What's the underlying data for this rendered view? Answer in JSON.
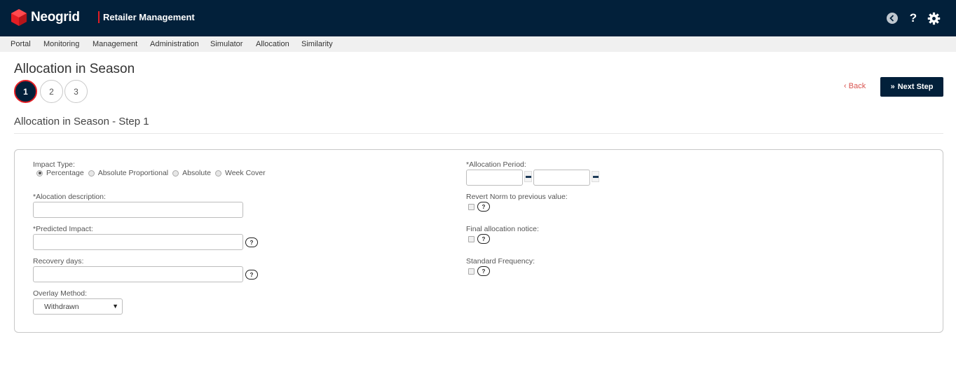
{
  "header": {
    "brand": "Neogrid",
    "app_title": "Retailer Management",
    "icons": [
      "back-circle-icon",
      "help-icon",
      "gear-icon"
    ]
  },
  "menu": {
    "items": [
      "Portal",
      "Monitoring",
      "Management",
      "Administration",
      "Simulator",
      "Allocation",
      "Similarity"
    ]
  },
  "page": {
    "title": "Allocation in Season",
    "steps": [
      "1",
      "2",
      "3"
    ],
    "active_step": "1",
    "back_label": "Back",
    "next_label": "Next Step",
    "section_title": "Allocation in Season - Step 1"
  },
  "form": {
    "impact_type": {
      "label": "Impact Type:",
      "options": [
        "Percentage",
        "Absolute Proportional",
        "Absolute",
        "Week Cover"
      ],
      "selected": "Percentage"
    },
    "allocation_description": {
      "label": "*Alocation description:",
      "value": ""
    },
    "predicted_impact": {
      "label": "*Predicted Impact:",
      "value": ""
    },
    "recovery_days": {
      "label": "Recovery days:",
      "value": ""
    },
    "overlay_method": {
      "label": "Overlay Method:",
      "value": "Withdrawn"
    },
    "allocation_period": {
      "label": "*Allocation Period:",
      "start": "",
      "end": ""
    },
    "revert_norm": {
      "label": "Revert Norm to previous value:",
      "checked": false
    },
    "final_notice": {
      "label": "Final allocation notice:",
      "checked": false
    },
    "standard_frequency": {
      "label": "Standard Frequency:",
      "checked": false
    },
    "help_glyph": "?"
  },
  "colors": {
    "header_bg": "#02203a",
    "accent_red": "#e31e24",
    "link_red": "#d9534f"
  }
}
